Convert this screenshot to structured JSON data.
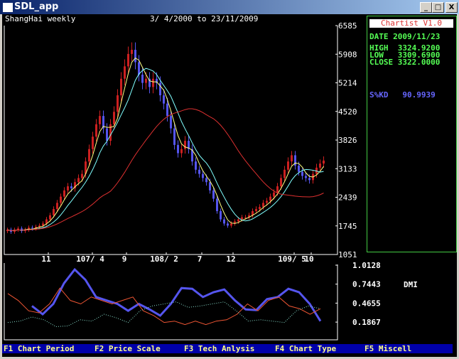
{
  "window": {
    "title": "SDL_app",
    "min": "_",
    "max": "□",
    "close": "X"
  },
  "chart": {
    "symbol_label": "ShangHai weekly",
    "range_label": "3/ 4/2000 to 23/11/2009"
  },
  "panel": {
    "title": "Chartist V1.0",
    "date": "DATE 2009/11/23",
    "high": "HIGH  3324.9200",
    "low": "LOW   3309.6900",
    "close": "CLOSE 3322.0000",
    "kd": "S%KD   90.9939"
  },
  "colors": {
    "up": "#cc2020",
    "down": "#5555ee",
    "ma_short": "#ffff80",
    "ma_mid": "#80ffff",
    "ma_long": "#dd3030",
    "dmi_main": "#5555ee",
    "dmi_red": "#ee5533",
    "dmi_dot": "#88ddcc"
  },
  "chart_data": [
    {
      "type": "candlestick",
      "title": "ShangHai weekly",
      "ylim": [
        1051,
        6585
      ],
      "y_ticks": [
        "6585",
        "5908",
        "5214",
        "4520",
        "3826",
        "3133",
        "2439",
        "1745",
        "1051"
      ],
      "x_ticks": [
        "11",
        "107/ 4",
        "9",
        "108/ 2",
        "7",
        "12",
        "109/ 5",
        "10"
      ],
      "closes": [
        1650,
        1600,
        1650,
        1680,
        1620,
        1650,
        1700,
        1680,
        1720,
        1750,
        1800,
        1900,
        2000,
        2150,
        2300,
        2450,
        2600,
        2700,
        2650,
        2800,
        2900,
        3000,
        3300,
        3600,
        3900,
        4200,
        4400,
        4100,
        3800,
        4200,
        4500,
        4900,
        5300,
        5600,
        5900,
        6000,
        5700,
        5400,
        5200,
        5300,
        5100,
        5300,
        5200,
        4900,
        4700,
        4400,
        4100,
        3700,
        3500,
        3600,
        3800,
        3600,
        3300,
        3100,
        3000,
        2900,
        2800,
        2600,
        2400,
        2100,
        1900,
        1800,
        1750,
        1800,
        1850,
        1900,
        1950,
        1950,
        2000,
        2100,
        2150,
        2200,
        2300,
        2350,
        2450,
        2550,
        2700,
        2900,
        3100,
        3300,
        3450,
        3200,
        3050,
        2950,
        2900,
        2850,
        3000,
        3150,
        3250,
        3322
      ]
    },
    {
      "type": "line",
      "title": "DMI",
      "ylim": [
        0.1867,
        1.0128
      ],
      "y_ticks": [
        "1.0128",
        "0.7443",
        "0.4655",
        "0.1867"
      ],
      "series": [
        {
          "name": "main",
          "start": 42,
          "values": [
            0.42,
            0.3,
            0.45,
            0.75,
            0.95,
            0.8,
            0.55,
            0.5,
            0.45,
            0.35,
            0.45,
            0.37,
            0.28,
            0.45,
            0.68,
            0.67,
            0.55,
            0.62,
            0.66,
            0.5,
            0.37,
            0.36,
            0.52,
            0.55,
            0.67,
            0.62,
            0.45,
            0.2
          ]
        },
        {
          "name": "red",
          "start": 8,
          "values": [
            0.6,
            0.5,
            0.35,
            0.32,
            0.45,
            0.68,
            0.5,
            0.45,
            0.55,
            0.5,
            0.45,
            0.5,
            0.55,
            0.35,
            0.28,
            0.18,
            0.2,
            0.15,
            0.2,
            0.15,
            0.2,
            0.22,
            0.3,
            0.45,
            0.35,
            0.5,
            0.55,
            0.42,
            0.38,
            0.3,
            0.38
          ]
        },
        {
          "name": "dotted",
          "start": 8,
          "values": [
            0.18,
            0.2,
            0.26,
            0.22,
            0.12,
            0.13,
            0.22,
            0.2,
            0.3,
            0.25,
            0.18,
            0.35,
            0.42,
            0.45,
            0.48,
            0.4,
            0.42,
            0.45,
            0.48,
            0.35,
            0.2,
            0.22,
            0.2,
            0.18,
            0.35,
            0.42,
            0.38
          ]
        }
      ]
    }
  ],
  "menu": [
    "F1 Chart Period",
    "F2 Price Scale",
    "F3 Tech Anlysis",
    "F4 Chart Type",
    "F5 Miscell"
  ]
}
